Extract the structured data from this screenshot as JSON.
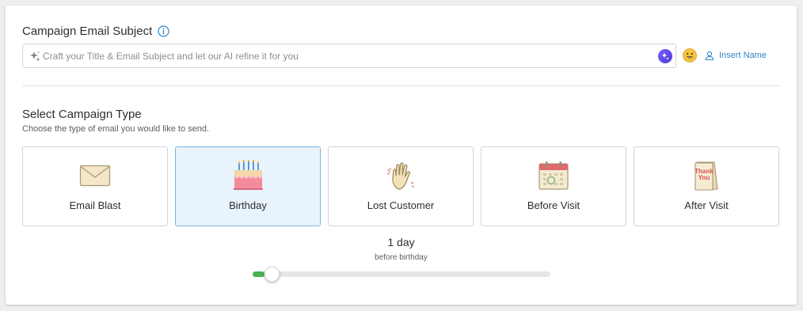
{
  "subject": {
    "title": "Campaign Email Subject",
    "placeholder": "Craft your Title & Email Subject and let our AI refine it for you",
    "value": "",
    "insert_name_label": "Insert Name"
  },
  "campaign_type": {
    "title": "Select Campaign Type",
    "subtitle": "Choose the type of email you would like to send.",
    "selected": "Birthday",
    "options": [
      {
        "label": "Email Blast",
        "icon": "envelope-icon"
      },
      {
        "label": "Birthday",
        "icon": "birthday-cake-icon"
      },
      {
        "label": "Lost Customer",
        "icon": "waving-hand-icon"
      },
      {
        "label": "Before Visit",
        "icon": "calendar-icon"
      },
      {
        "label": "After Visit",
        "icon": "thank-you-card-icon"
      }
    ]
  },
  "timing": {
    "value_label": "1 day",
    "caption": "before birthday",
    "slider_fraction": 0.04
  },
  "colors": {
    "accent_blue": "#2f86c9",
    "selected_bg": "#e8f3fb",
    "slider_fill": "#4caf50"
  }
}
